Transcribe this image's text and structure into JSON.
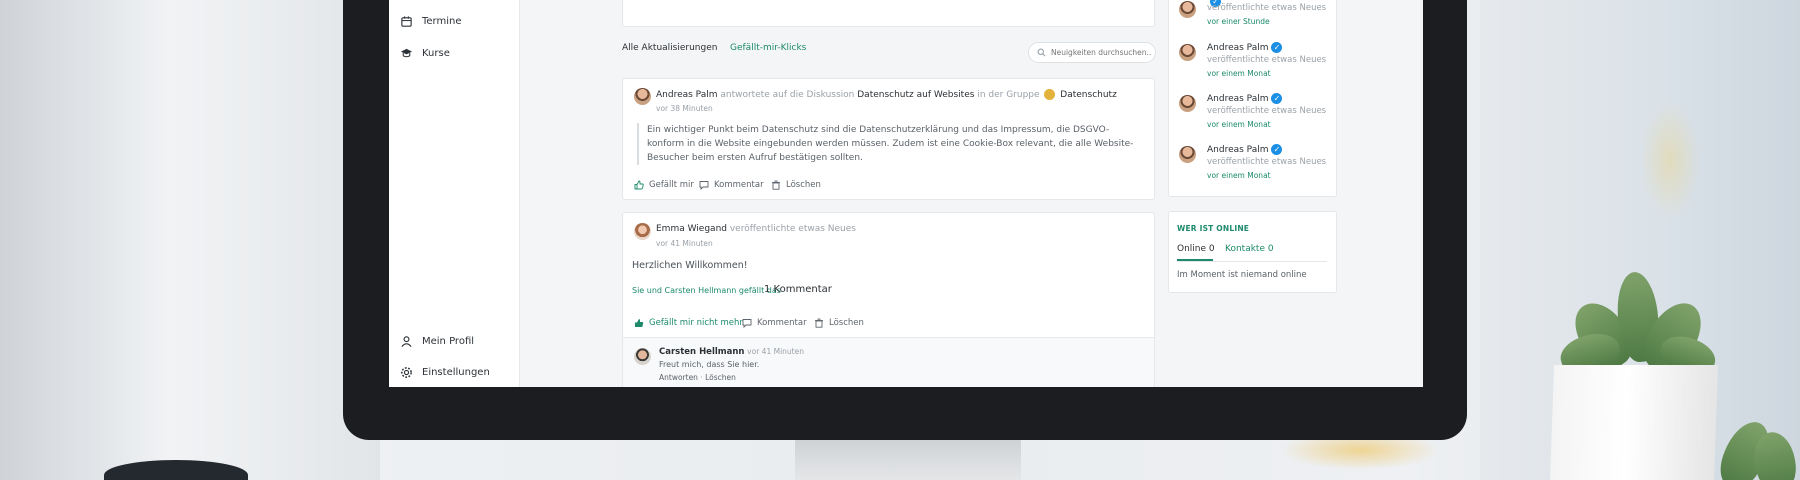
{
  "sidebar": {
    "top_items": [
      {
        "label": "Termine",
        "icon": "calendar-icon"
      },
      {
        "label": "Kurse",
        "icon": "graduation-cap-icon"
      }
    ],
    "bottom_items": [
      {
        "label": "Mein Profil",
        "icon": "user-icon"
      },
      {
        "label": "Einstellungen",
        "icon": "gear-icon"
      }
    ]
  },
  "feed": {
    "tabs": [
      {
        "label": "Alle Aktualisierungen",
        "active": true
      },
      {
        "label": "Gefällt-mir-Klicks",
        "active": false
      }
    ],
    "search_placeholder": "Neuigkeiten durchsuchen...",
    "post1": {
      "author": "Andreas Palm",
      "verb": "antwortete auf die Diskussion",
      "discussion": "Datenschutz auf Websites",
      "in_group": "in der Gruppe",
      "group": "Datenschutz",
      "time": "vor 38 Minuten",
      "quote_lines": [
        "Ein wichtiger Punkt beim Datenschutz sind die Datenschutzerklärung und das Impressum, die DSGVO-",
        "konform in die Website eingebunden werden müssen. Zudem ist eine Cookie-Box relevant, die alle Website-",
        "Besucher beim ersten Aufruf bestätigen sollten."
      ],
      "actions": {
        "like": "Gefällt mir",
        "comment": "Kommentar",
        "delete": "Löschen"
      }
    },
    "post2": {
      "author": "Emma Wiegand",
      "verb": "veröffentlichte etwas Neues",
      "time": "vor 41 Minuten",
      "body": "Herzlichen Willkommen!",
      "likes_text": "Sie und Carsten Hellmann gefällt das",
      "comment_count": "1 Kommentar",
      "actions": {
        "unlike": "Gefällt mir nicht mehr",
        "comment": "Kommentar",
        "delete": "Löschen"
      },
      "comment": {
        "author": "Carsten Hellmann",
        "time": "vor 41 Minuten",
        "text": "Freut mich, dass Sie hier.",
        "reply": "Antworten",
        "delete": "Löschen"
      }
    }
  },
  "activity": {
    "items": [
      {
        "name": "",
        "text": "veröffentlichte etwas Neues",
        "time": "vor einer Stunde"
      },
      {
        "name": "Andreas Palm",
        "text": "veröffentlichte etwas Neues",
        "time": "vor einem Monat"
      },
      {
        "name": "Andreas Palm",
        "text": "veröffentlichte etwas Neues",
        "time": "vor einem Monat"
      },
      {
        "name": "Andreas Palm",
        "text": "veröffentlichte etwas Neues",
        "time": "vor einem Monat"
      }
    ]
  },
  "online": {
    "title": "WER IST ONLINE",
    "tabs": [
      {
        "label": "Online 0",
        "active": true
      },
      {
        "label": "Kontakte 0",
        "active": false
      }
    ],
    "empty_text": "Im Moment ist niemand online"
  },
  "colors": {
    "accent": "#1c8a6b",
    "verified": "#1b8ee5",
    "bezel": "#1b1d20"
  }
}
